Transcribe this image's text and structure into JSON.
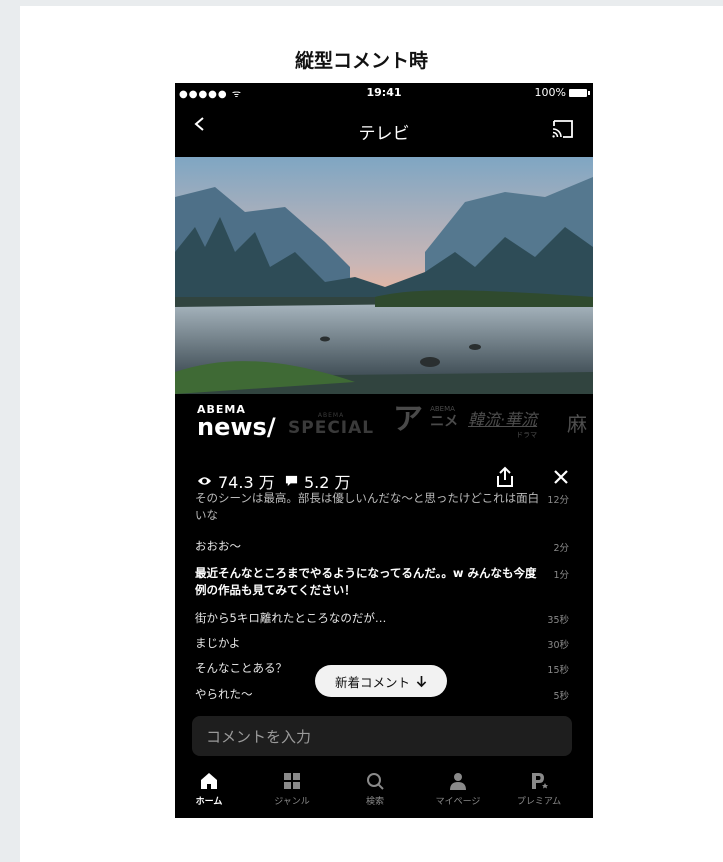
{
  "page": {
    "heading": "縦型コメント時"
  },
  "status_bar": {
    "signal": "●●●●● ",
    "wifi": "ᯤ",
    "time": "19:41",
    "battery": "100%"
  },
  "nav": {
    "title": "テレビ"
  },
  "channels": {
    "news_top": "ABEMA",
    "news_main": "news/",
    "special_top": "ABEMA",
    "special_main": "SPECIAL",
    "anime_main": "ア",
    "anime_top": "ABEMA",
    "anime_sub": "ニメ",
    "drama_main": "韓流·華流",
    "drama_sub": "ドラマ",
    "mahjong": "麻"
  },
  "stats": {
    "views": "74.3 万",
    "comments": "5.2 万"
  },
  "comments": [
    {
      "text": "そのシーンは最高。部長は優しいんだな〜と思ったけどこれは面白いな",
      "time": "12分",
      "bold": false
    },
    {
      "text": "おおお〜",
      "time": "2分",
      "bold": false
    },
    {
      "text": "最近そんなところまでやるようになってるんだ。。w みんなも今度例の作品も見てみてください！",
      "time": "1分",
      "bold": true
    },
    {
      "text": "街から5キロ離れたところなのだが…",
      "time": "35秒",
      "bold": false
    },
    {
      "text": "まじかよ",
      "time": "30秒",
      "bold": false
    },
    {
      "text": "そんなことある？",
      "time": "15秒",
      "bold": false
    },
    {
      "text": "やられた〜",
      "time": "5秒",
      "bold": false
    }
  ],
  "new_comment_button": "新着コメント",
  "comment_input": {
    "placeholder": "コメントを入力"
  },
  "tabs": [
    {
      "label": "ホーム",
      "icon": "home-icon"
    },
    {
      "label": "ジャンル",
      "icon": "grid-icon"
    },
    {
      "label": "検索",
      "icon": "search-icon"
    },
    {
      "label": "マイページ",
      "icon": "person-icon"
    },
    {
      "label": "プレミアム",
      "icon": "premium-icon"
    }
  ]
}
